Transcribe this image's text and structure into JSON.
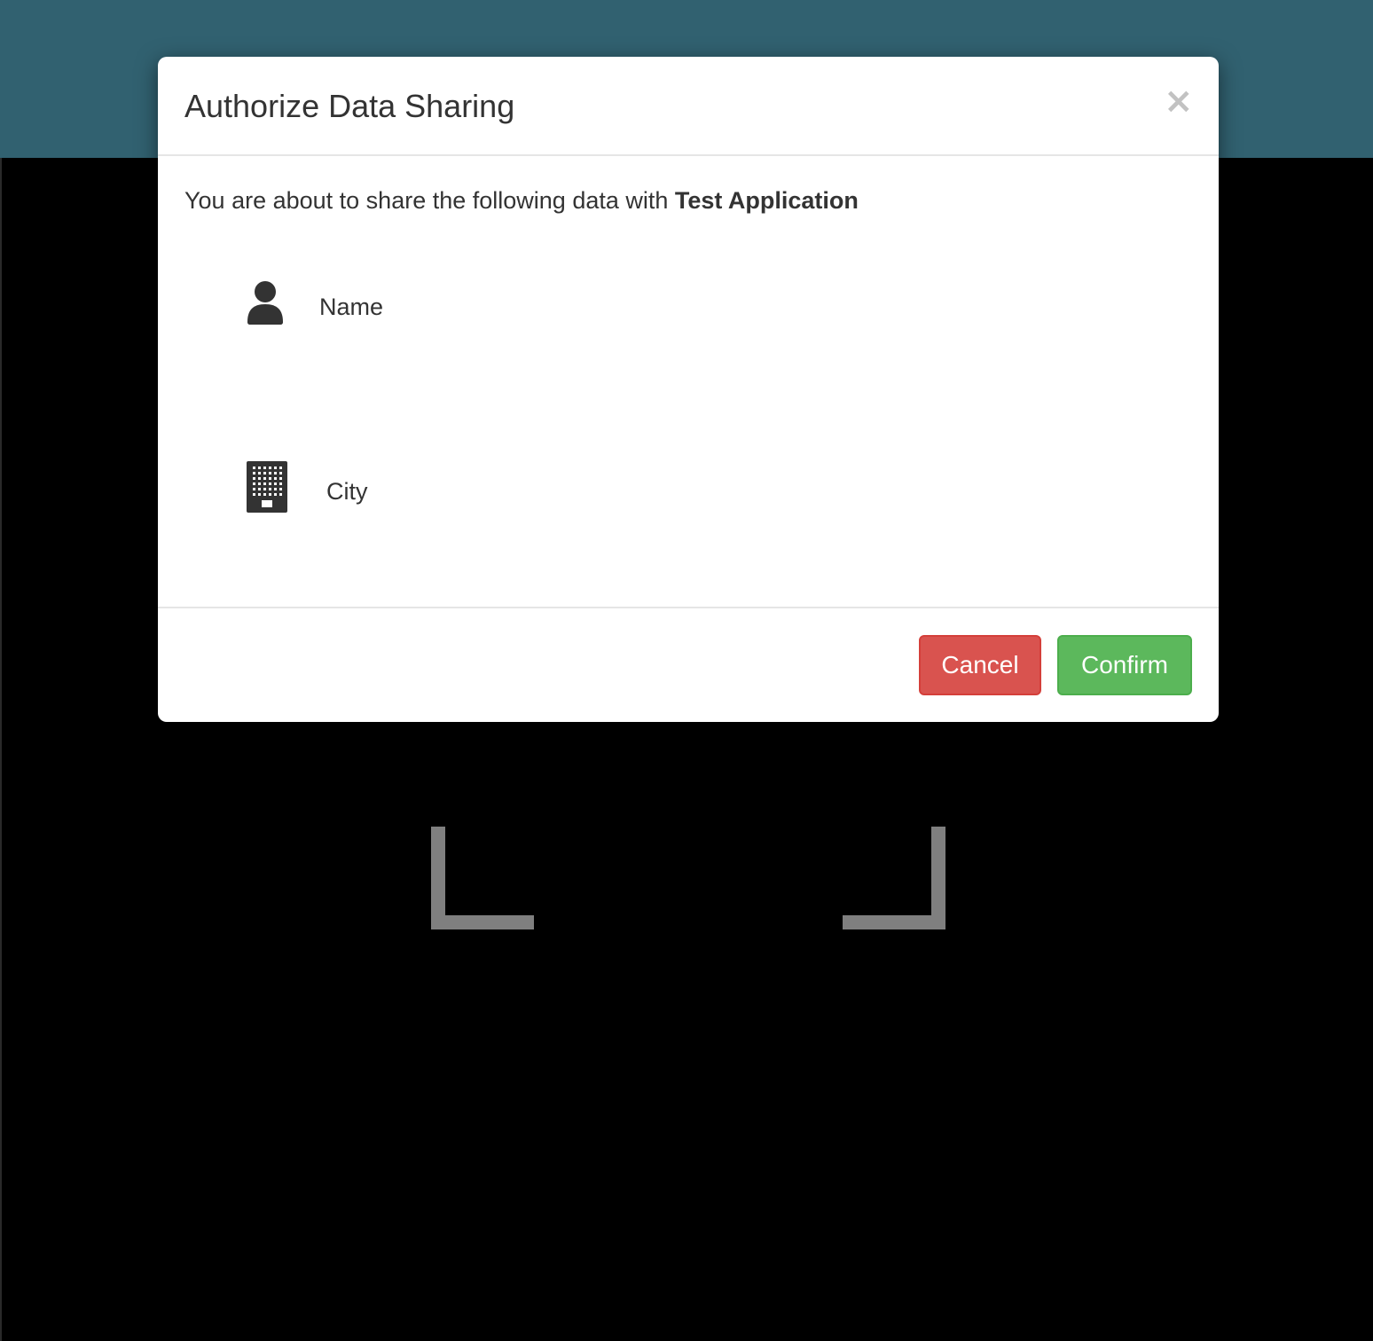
{
  "modal": {
    "title": "Authorize Data Sharing",
    "close_label": "×",
    "intro_prefix": "You are about to share the following data with ",
    "app_name": "Test Application",
    "items": [
      {
        "label": "Name",
        "icon": "user-icon"
      },
      {
        "label": "City",
        "icon": "building-icon"
      }
    ],
    "buttons": {
      "cancel": "Cancel",
      "confirm": "Confirm"
    }
  },
  "colors": {
    "header_band": "#316170",
    "backdrop": "#000000",
    "cancel": "#d9534f",
    "confirm": "#5cb85c",
    "text": "#333333"
  }
}
